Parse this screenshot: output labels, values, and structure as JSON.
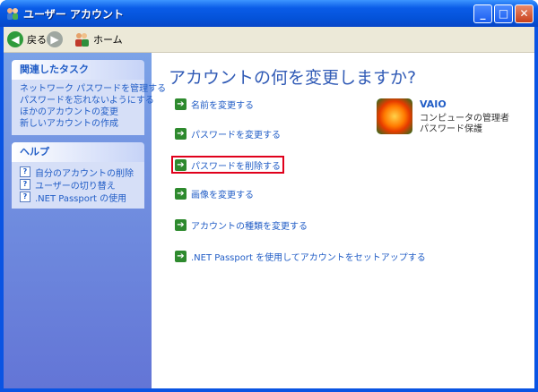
{
  "window": {
    "title": "ユーザー アカウント"
  },
  "toolbar": {
    "back": "戻る",
    "home": "ホーム"
  },
  "sidebar": {
    "tasks_title": "関連したタスク",
    "tasks": [
      "ネットワーク パスワードを管理する",
      "パスワードを忘れないようにする",
      "ほかのアカウントの変更",
      "新しいアカウントの作成"
    ],
    "help_title": "ヘルプ",
    "help": [
      "自分のアカウントの削除",
      "ユーザーの切り替え",
      ".NET Passport の使用"
    ]
  },
  "main": {
    "heading": "アカウントの何を変更しますか?",
    "actions": [
      "名前を変更する",
      "パスワードを変更する",
      "パスワードを削除する",
      "画像を変更する",
      "アカウントの種類を変更する",
      ".NET Passport を使用してアカウントをセットアップする"
    ]
  },
  "account": {
    "name": "VAIO",
    "type": "コンピュータの管理者",
    "status": "パスワード保護"
  },
  "colors": {
    "highlight": "#e0001b",
    "link": "#215dc6",
    "titlebar": "#0a5ce8"
  }
}
